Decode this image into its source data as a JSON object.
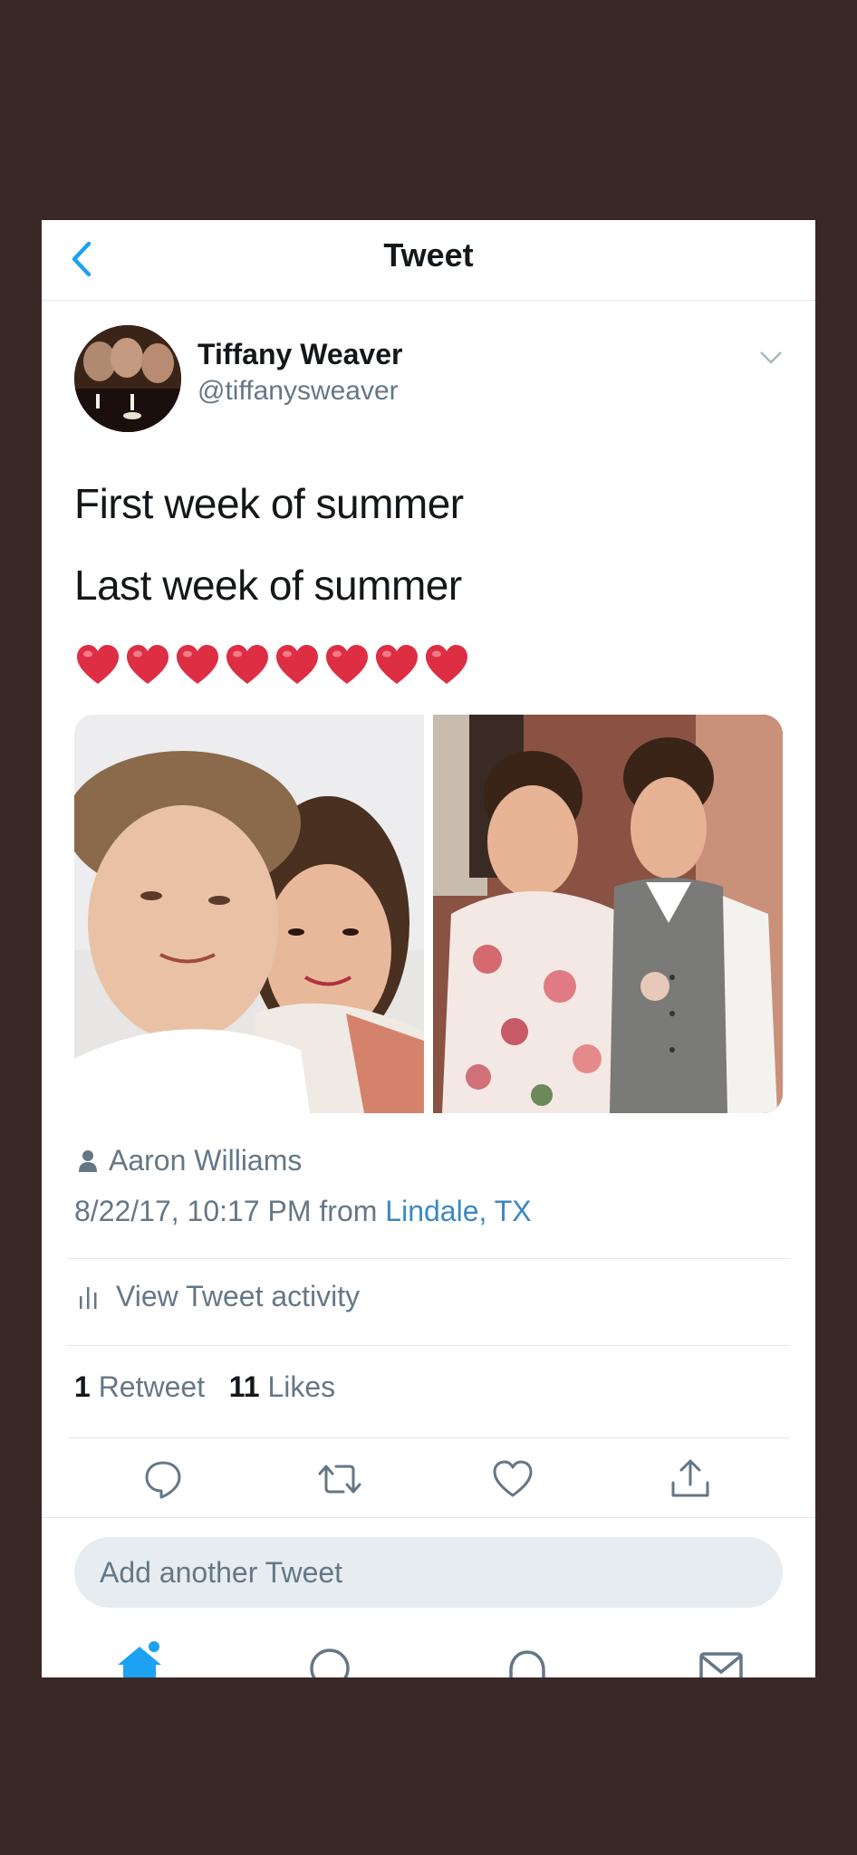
{
  "navbar": {
    "title": "Tweet"
  },
  "author": {
    "name": "Tiffany Weaver",
    "handle": "@tiffanysweaver"
  },
  "tweet": {
    "lines": [
      "First week of summer",
      "Last week of summer"
    ],
    "heart_count": 8
  },
  "tagged_user": "Aaron Williams",
  "meta": {
    "timestamp": "8/22/17, 10:17 PM",
    "from_word": "from",
    "location": "Lindale, TX"
  },
  "activity_label": "View Tweet activity",
  "counts": {
    "retweets": "1",
    "retweets_label": "Retweet",
    "likes": "11",
    "likes_label": "Likes"
  },
  "reply_placeholder": "Add another Tweet",
  "icons": {
    "actions": [
      "reply-icon",
      "retweet-icon",
      "like-icon",
      "share-icon"
    ],
    "tabs": [
      "home-icon",
      "search-icon",
      "notifications-icon",
      "messages-icon"
    ]
  },
  "colors": {
    "accent": "#1da1f2",
    "heart": "#dd2e44",
    "background": "#3a2826",
    "text": "#14171a",
    "secondary": "#657786"
  }
}
